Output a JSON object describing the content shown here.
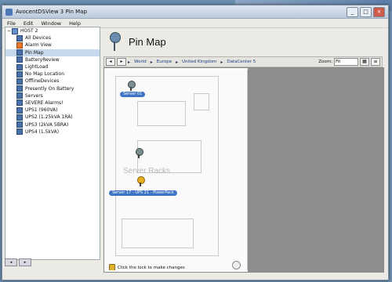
{
  "window": {
    "title": "AvocentDSView 3 Pin Map",
    "controls": [
      "_",
      "□",
      "×"
    ]
  },
  "menu": [
    "File",
    "Edit",
    "Window",
    "Help"
  ],
  "sidebar": {
    "items": [
      {
        "label": "HOST 2",
        "level": 0,
        "style": "root",
        "toggle": "−"
      },
      {
        "label": "All Devices",
        "level": 1,
        "style": "normal"
      },
      {
        "label": "Alarm View",
        "level": 1,
        "style": "orange"
      },
      {
        "label": "Pin Map",
        "level": 1,
        "style": "selected"
      },
      {
        "label": "BatteryReview",
        "level": 1,
        "style": "normal"
      },
      {
        "label": "LightLoad",
        "level": 1,
        "style": "normal"
      },
      {
        "label": "No Map Location",
        "level": 1,
        "style": "normal"
      },
      {
        "label": "OfflineDevices",
        "level": 1,
        "style": "normal"
      },
      {
        "label": "Presently On Battery",
        "level": 1,
        "style": "normal"
      },
      {
        "label": "Servers",
        "level": 1,
        "style": "normal"
      },
      {
        "label": "SEVERE Alarms!",
        "level": 1,
        "style": "normal"
      },
      {
        "label": "UPS1 (960VA)",
        "level": 1,
        "style": "normal"
      },
      {
        "label": "UPS2 (1.25kVA 1RA)",
        "level": 1,
        "style": "normal"
      },
      {
        "label": "UPS3 (2kVA 5BRA)",
        "level": 1,
        "style": "normal"
      },
      {
        "label": "UPS4 (1.5kVA)",
        "level": 1,
        "style": "normal"
      }
    ],
    "buttons": [
      "◂",
      "▸"
    ]
  },
  "main": {
    "page_title": "Pin Map",
    "toolbar": {
      "nav_buttons": [
        "◂",
        "▸"
      ],
      "breadcrumbs": [
        "World",
        "Europe",
        "United Kingdom",
        "DataCenter 5"
      ],
      "zoom_label": "Zoom:",
      "zoom_value": "Fit"
    },
    "map": {
      "room_label": "Server Racks",
      "pins": [
        {
          "label": "Server 01",
          "color": "gray"
        },
        {
          "label": "",
          "color": "gray"
        },
        {
          "label": "Server 17 - UPS 21 - PowerPack",
          "color": "gold"
        }
      ],
      "lock_note": "Click the lock to make changes"
    }
  }
}
